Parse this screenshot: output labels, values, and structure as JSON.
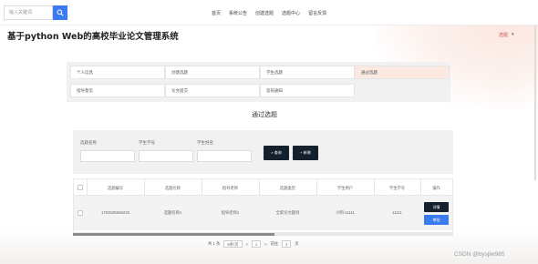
{
  "search": {
    "placeholder": "输入关键词"
  },
  "topnav": [
    "首页",
    "系统公告",
    "创建选题",
    "选题中心",
    "留言反馈"
  ],
  "page_title": "基于python Web的高校毕业论文管理系统",
  "user_menu": {
    "label": "选题",
    "caret": "▾"
  },
  "menu_items": [
    {
      "label": "个人信息",
      "active": false
    },
    {
      "label": "创建选题",
      "active": false
    },
    {
      "label": "学生选题",
      "active": false
    },
    {
      "label": "通过选题",
      "active": true
    },
    {
      "label": "指导意见",
      "active": false
    },
    {
      "label": "论文提交",
      "active": false
    },
    {
      "label": "答辩通知",
      "active": false
    }
  ],
  "section_title": "通过选题",
  "filters": {
    "labels": [
      "选题名称",
      "学生学号",
      "学生姓名"
    ],
    "search_button": "查询",
    "add_button": "新增"
  },
  "table": {
    "headers": [
      "选题编号",
      "选题名称",
      "指导老师",
      "选题类型",
      "学生用户",
      "学生学号",
      "操作"
    ],
    "row": {
      "id": "1763535566225",
      "name": "选题名称1",
      "teacher": "指导老师1",
      "type": "全职论文题目",
      "user": "小明-11111",
      "student_no": "11111",
      "detail_button": "详情",
      "action_button": "审批"
    }
  },
  "pagination": {
    "total": "共 1 条",
    "page_size": "5条/页",
    "prev": "<",
    "page": "1",
    "next": ">",
    "goto_label": "前往",
    "goto_value": "1",
    "page_unit": "页"
  },
  "watermark": "CSDN @bysjlw985"
}
